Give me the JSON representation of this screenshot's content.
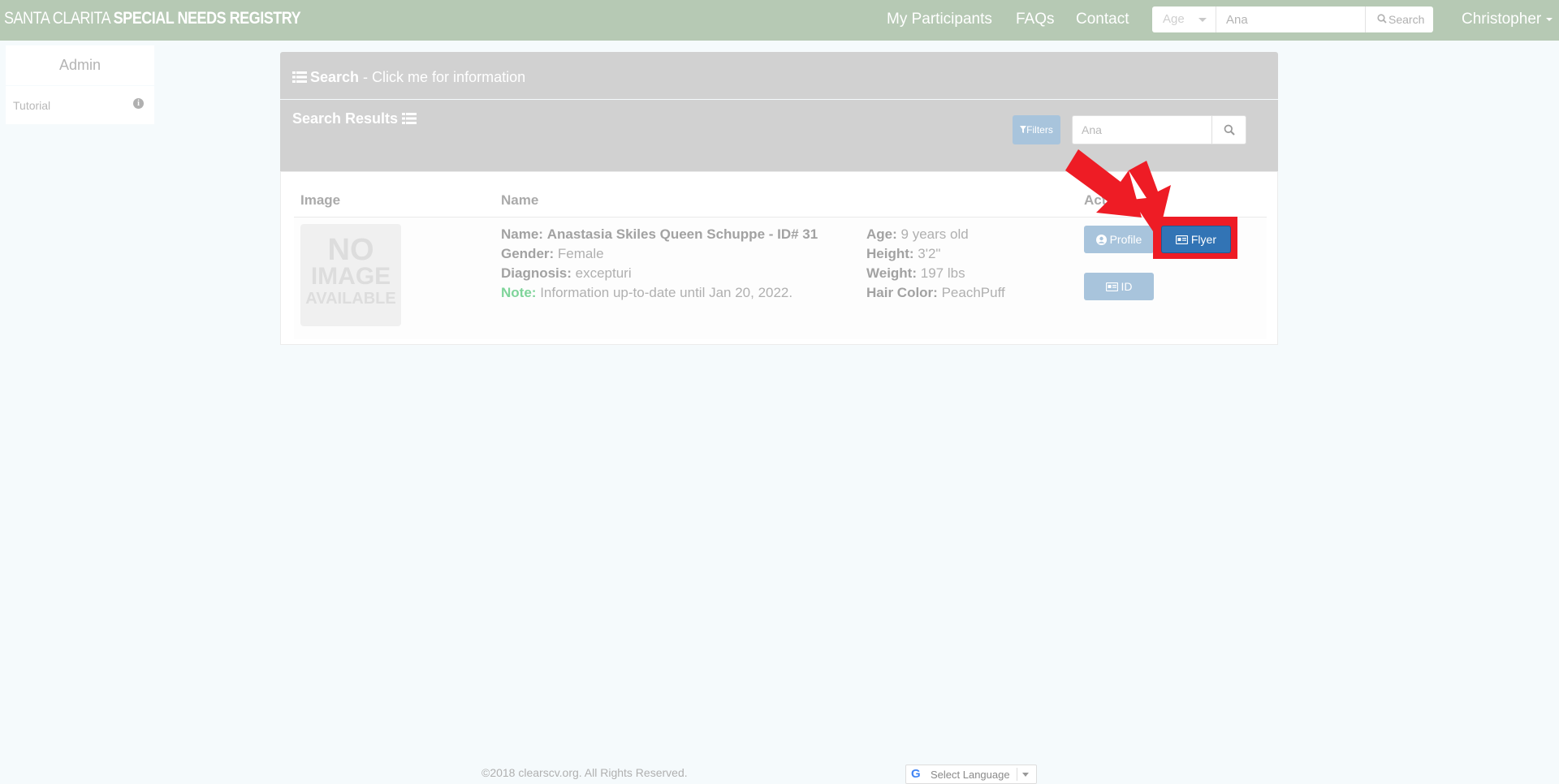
{
  "navbar": {
    "brand_light": "SANTA CLARITA",
    "brand_bold": "SPECIAL NEEDS REGISTRY",
    "links": [
      "My Participants",
      "FAQs",
      "Contact"
    ],
    "search": {
      "select_value": "Age",
      "input_value": "Ana",
      "button_label": "Search"
    },
    "user_name": "Christopher"
  },
  "sidebar": {
    "header": "Admin",
    "items": [
      {
        "label": "Tutorial"
      }
    ]
  },
  "search_panel": {
    "title": "Search",
    "subtitle": " - Click me for information"
  },
  "results_panel": {
    "title": "Search Results",
    "filters_label": "Filters",
    "search_value": "Ana"
  },
  "table": {
    "headers": [
      "Image",
      "Name",
      "Actions"
    ],
    "rows": [
      {
        "image_text": [
          "NO",
          "IMAGE",
          "AVAILABLE"
        ],
        "name_label": "Name:",
        "name_value": "Anastasia Skiles Queen Schuppe - ID# 31",
        "gender_label": "Gender:",
        "gender_value": "Female",
        "diagnosis_label": "Diagnosis:",
        "diagnosis_value": "excepturi",
        "note_label": "Note:",
        "note_value": "Information up-to-date until Jan 20, 2022.",
        "age_label": "Age:",
        "age_value": "9 years old",
        "height_label": "Height:",
        "height_value": "3'2\"",
        "weight_label": "Weight:",
        "weight_value": "197 lbs",
        "hair_label": "Hair Color:",
        "hair_value": "PeachPuff",
        "actions": {
          "profile_label": "Profile",
          "flyer_label": "Flyer",
          "id_label": "ID"
        }
      }
    ]
  },
  "footer": {
    "copyright": "©2018 clearscv.org. All Rights Reserved.",
    "language_label": "Select Language"
  },
  "colors": {
    "navbar": "#b6c9b4",
    "highlight": "#ee1c25",
    "flyer_button": "#3274b5",
    "note": "#7fd49a"
  }
}
